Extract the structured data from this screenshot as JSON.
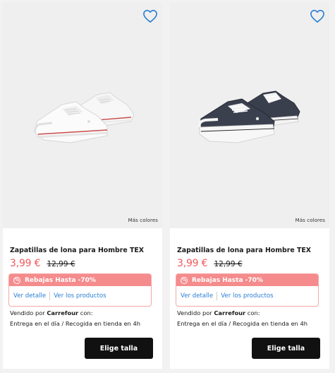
{
  "products": [
    {
      "more_colors": "Más colores",
      "title": "Zapatillas de lona para Hombre TEX",
      "price_now": "3,99 €",
      "price_old": "12,99 €",
      "promo_label": "Rebajas Hasta -70%",
      "promo_icon": "%",
      "link_detail": "Ver detalle",
      "link_products": "Ver los productos",
      "seller_prefix": "Vendido por ",
      "seller_name": "Carrefour",
      "seller_suffix": " con:",
      "delivery": "Entrega en el día /  Recogida en tienda en 4h",
      "cta": "Elige talla",
      "shoe_color": "white"
    },
    {
      "more_colors": "Más colores",
      "title": "Zapatillas de lona para Hombre TEX",
      "price_now": "3,99 €",
      "price_old": "12,99 €",
      "promo_label": "Rebajas Hasta -70%",
      "promo_icon": "%",
      "link_detail": "Ver detalle",
      "link_products": "Ver los productos",
      "seller_prefix": "Vendido por ",
      "seller_name": "Carrefour",
      "seller_suffix": " con:",
      "delivery": "Entrega en el día /  Recogida en tienda en 4h",
      "cta": "Elige talla",
      "shoe_color": "navy"
    }
  ],
  "colors": {
    "price": "#f0595b",
    "promo_bg": "#f58b8c",
    "link": "#2b7fd4",
    "button": "#111111",
    "favorite_icon": "#2b7fd4"
  },
  "icons": [
    "heart-outline-icon",
    "percent-tag-icon"
  ]
}
